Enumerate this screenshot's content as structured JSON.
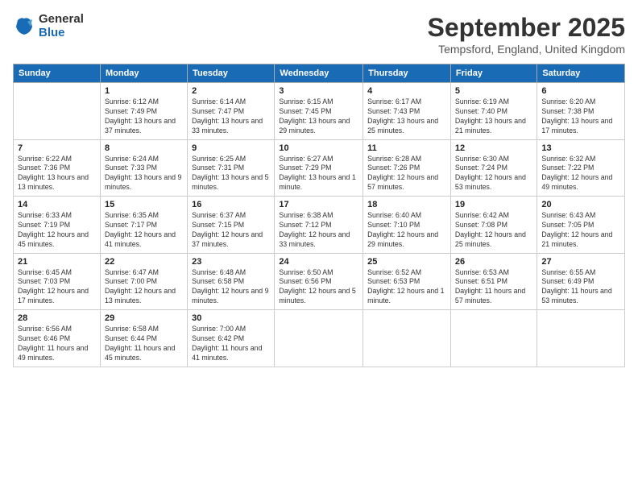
{
  "header": {
    "logo_general": "General",
    "logo_blue": "Blue",
    "month_title": "September 2025",
    "location": "Tempsford, England, United Kingdom"
  },
  "weekdays": [
    "Sunday",
    "Monday",
    "Tuesday",
    "Wednesday",
    "Thursday",
    "Friday",
    "Saturday"
  ],
  "weeks": [
    [
      {
        "day": "",
        "sunrise": "",
        "sunset": "",
        "daylight": ""
      },
      {
        "day": "1",
        "sunrise": "Sunrise: 6:12 AM",
        "sunset": "Sunset: 7:49 PM",
        "daylight": "Daylight: 13 hours and 37 minutes."
      },
      {
        "day": "2",
        "sunrise": "Sunrise: 6:14 AM",
        "sunset": "Sunset: 7:47 PM",
        "daylight": "Daylight: 13 hours and 33 minutes."
      },
      {
        "day": "3",
        "sunrise": "Sunrise: 6:15 AM",
        "sunset": "Sunset: 7:45 PM",
        "daylight": "Daylight: 13 hours and 29 minutes."
      },
      {
        "day": "4",
        "sunrise": "Sunrise: 6:17 AM",
        "sunset": "Sunset: 7:43 PM",
        "daylight": "Daylight: 13 hours and 25 minutes."
      },
      {
        "day": "5",
        "sunrise": "Sunrise: 6:19 AM",
        "sunset": "Sunset: 7:40 PM",
        "daylight": "Daylight: 13 hours and 21 minutes."
      },
      {
        "day": "6",
        "sunrise": "Sunrise: 6:20 AM",
        "sunset": "Sunset: 7:38 PM",
        "daylight": "Daylight: 13 hours and 17 minutes."
      }
    ],
    [
      {
        "day": "7",
        "sunrise": "Sunrise: 6:22 AM",
        "sunset": "Sunset: 7:36 PM",
        "daylight": "Daylight: 13 hours and 13 minutes."
      },
      {
        "day": "8",
        "sunrise": "Sunrise: 6:24 AM",
        "sunset": "Sunset: 7:33 PM",
        "daylight": "Daylight: 13 hours and 9 minutes."
      },
      {
        "day": "9",
        "sunrise": "Sunrise: 6:25 AM",
        "sunset": "Sunset: 7:31 PM",
        "daylight": "Daylight: 13 hours and 5 minutes."
      },
      {
        "day": "10",
        "sunrise": "Sunrise: 6:27 AM",
        "sunset": "Sunset: 7:29 PM",
        "daylight": "Daylight: 13 hours and 1 minute."
      },
      {
        "day": "11",
        "sunrise": "Sunrise: 6:28 AM",
        "sunset": "Sunset: 7:26 PM",
        "daylight": "Daylight: 12 hours and 57 minutes."
      },
      {
        "day": "12",
        "sunrise": "Sunrise: 6:30 AM",
        "sunset": "Sunset: 7:24 PM",
        "daylight": "Daylight: 12 hours and 53 minutes."
      },
      {
        "day": "13",
        "sunrise": "Sunrise: 6:32 AM",
        "sunset": "Sunset: 7:22 PM",
        "daylight": "Daylight: 12 hours and 49 minutes."
      }
    ],
    [
      {
        "day": "14",
        "sunrise": "Sunrise: 6:33 AM",
        "sunset": "Sunset: 7:19 PM",
        "daylight": "Daylight: 12 hours and 45 minutes."
      },
      {
        "day": "15",
        "sunrise": "Sunrise: 6:35 AM",
        "sunset": "Sunset: 7:17 PM",
        "daylight": "Daylight: 12 hours and 41 minutes."
      },
      {
        "day": "16",
        "sunrise": "Sunrise: 6:37 AM",
        "sunset": "Sunset: 7:15 PM",
        "daylight": "Daylight: 12 hours and 37 minutes."
      },
      {
        "day": "17",
        "sunrise": "Sunrise: 6:38 AM",
        "sunset": "Sunset: 7:12 PM",
        "daylight": "Daylight: 12 hours and 33 minutes."
      },
      {
        "day": "18",
        "sunrise": "Sunrise: 6:40 AM",
        "sunset": "Sunset: 7:10 PM",
        "daylight": "Daylight: 12 hours and 29 minutes."
      },
      {
        "day": "19",
        "sunrise": "Sunrise: 6:42 AM",
        "sunset": "Sunset: 7:08 PM",
        "daylight": "Daylight: 12 hours and 25 minutes."
      },
      {
        "day": "20",
        "sunrise": "Sunrise: 6:43 AM",
        "sunset": "Sunset: 7:05 PM",
        "daylight": "Daylight: 12 hours and 21 minutes."
      }
    ],
    [
      {
        "day": "21",
        "sunrise": "Sunrise: 6:45 AM",
        "sunset": "Sunset: 7:03 PM",
        "daylight": "Daylight: 12 hours and 17 minutes."
      },
      {
        "day": "22",
        "sunrise": "Sunrise: 6:47 AM",
        "sunset": "Sunset: 7:00 PM",
        "daylight": "Daylight: 12 hours and 13 minutes."
      },
      {
        "day": "23",
        "sunrise": "Sunrise: 6:48 AM",
        "sunset": "Sunset: 6:58 PM",
        "daylight": "Daylight: 12 hours and 9 minutes."
      },
      {
        "day": "24",
        "sunrise": "Sunrise: 6:50 AM",
        "sunset": "Sunset: 6:56 PM",
        "daylight": "Daylight: 12 hours and 5 minutes."
      },
      {
        "day": "25",
        "sunrise": "Sunrise: 6:52 AM",
        "sunset": "Sunset: 6:53 PM",
        "daylight": "Daylight: 12 hours and 1 minute."
      },
      {
        "day": "26",
        "sunrise": "Sunrise: 6:53 AM",
        "sunset": "Sunset: 6:51 PM",
        "daylight": "Daylight: 11 hours and 57 minutes."
      },
      {
        "day": "27",
        "sunrise": "Sunrise: 6:55 AM",
        "sunset": "Sunset: 6:49 PM",
        "daylight": "Daylight: 11 hours and 53 minutes."
      }
    ],
    [
      {
        "day": "28",
        "sunrise": "Sunrise: 6:56 AM",
        "sunset": "Sunset: 6:46 PM",
        "daylight": "Daylight: 11 hours and 49 minutes."
      },
      {
        "day": "29",
        "sunrise": "Sunrise: 6:58 AM",
        "sunset": "Sunset: 6:44 PM",
        "daylight": "Daylight: 11 hours and 45 minutes."
      },
      {
        "day": "30",
        "sunrise": "Sunrise: 7:00 AM",
        "sunset": "Sunset: 6:42 PM",
        "daylight": "Daylight: 11 hours and 41 minutes."
      },
      {
        "day": "",
        "sunrise": "",
        "sunset": "",
        "daylight": ""
      },
      {
        "day": "",
        "sunrise": "",
        "sunset": "",
        "daylight": ""
      },
      {
        "day": "",
        "sunrise": "",
        "sunset": "",
        "daylight": ""
      },
      {
        "day": "",
        "sunrise": "",
        "sunset": "",
        "daylight": ""
      }
    ]
  ]
}
